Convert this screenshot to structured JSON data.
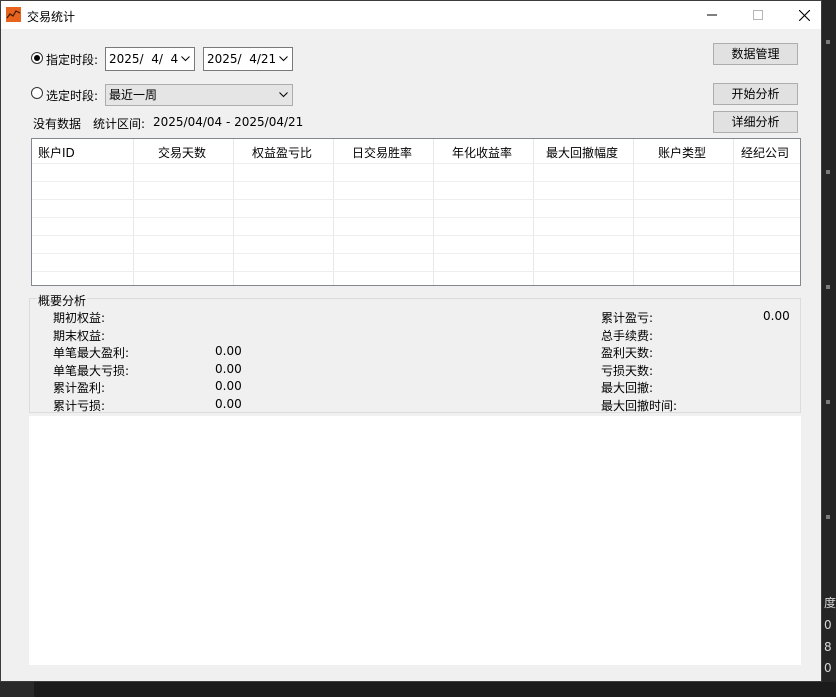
{
  "window": {
    "title": "交易统计",
    "controls": {
      "minimize": "—",
      "maximize": "☐",
      "close": "✕"
    }
  },
  "filters": {
    "specified": {
      "label": "指定时段:",
      "selected": true,
      "start_date": "2025/  4/  4",
      "end_date": "2025/  4/21"
    },
    "preset": {
      "label": "选定时段:",
      "selected": false,
      "value": "最近一周"
    }
  },
  "status": {
    "message": "没有数据",
    "range_label": "统计区间:",
    "range_value": "2025/04/04 - 2025/04/21"
  },
  "buttons": {
    "data_manage": "数据管理",
    "start_analysis": "开始分析",
    "detail_analysis": "详细分析"
  },
  "table": {
    "columns": [
      "账户ID",
      "交易天数",
      "权益盈亏比",
      "日交易胜率",
      "年化收益率",
      "最大回撤幅度",
      "账户类型",
      "经纪公司"
    ],
    "rows": []
  },
  "summary": {
    "title": "概要分析",
    "left": [
      {
        "label": "期初权益:",
        "value": ""
      },
      {
        "label": "期末权益:",
        "value": ""
      },
      {
        "label": "单笔最大盈利:",
        "value": "0.00"
      },
      {
        "label": "单笔最大亏损:",
        "value": "0.00"
      },
      {
        "label": "累计盈利:",
        "value": "0.00"
      },
      {
        "label": "累计亏损:",
        "value": "0.00"
      }
    ],
    "right": [
      {
        "label": "累计盈亏:",
        "value": "0.00"
      },
      {
        "label": "总手续费:",
        "value": ""
      },
      {
        "label": "盈利天数:",
        "value": ""
      },
      {
        "label": "亏损天数:",
        "value": ""
      },
      {
        "label": "最大回撤:",
        "value": ""
      },
      {
        "label": "最大回撤时间:",
        "value": ""
      }
    ]
  },
  "background_app": {
    "fragments": [
      "度",
      "0",
      "8",
      "0"
    ]
  },
  "colors": {
    "title_bar": "#ffffff",
    "window_bg": "#f0f0f0",
    "button_bg": "#e1e1e1",
    "app_icon": "#e8641e"
  }
}
